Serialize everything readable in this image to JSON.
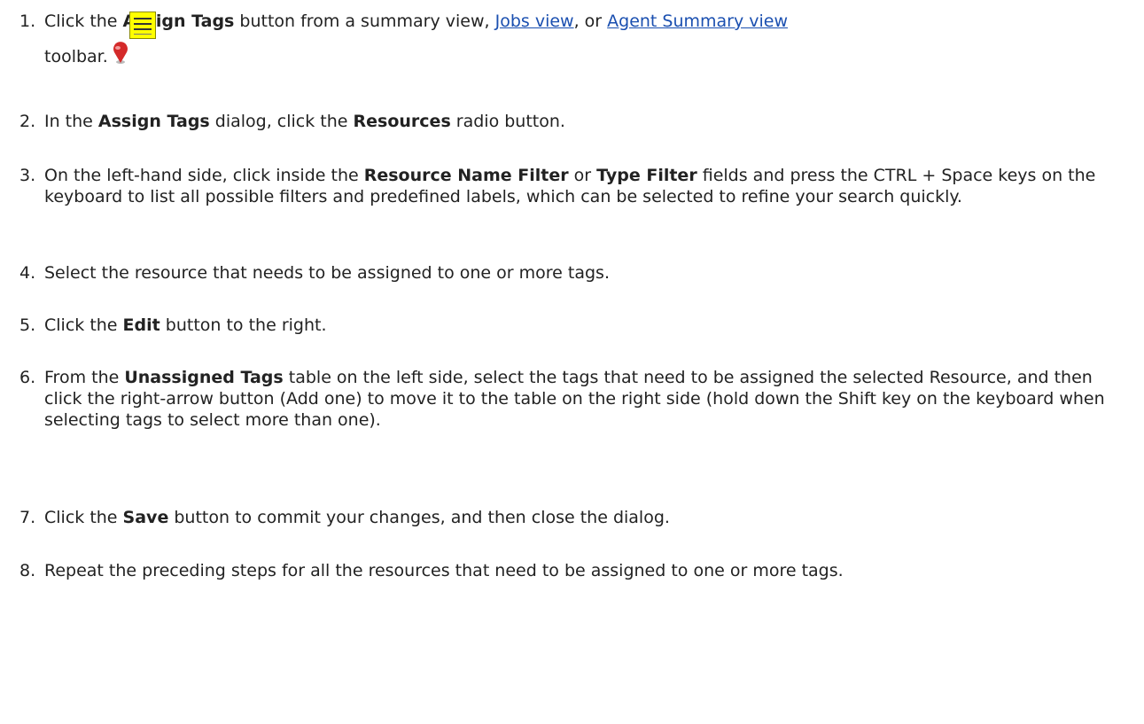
{
  "steps": [
    {
      "num": "1.",
      "p1": "Click the ",
      "b1": "Assign Tags",
      "p2": " button from a summary view, ",
      "link1": "Jobs view",
      "p3": ", or ",
      "link2": "Agent Summary view",
      "p4": "toolbar."
    },
    {
      "num": "2.",
      "p1": "In the ",
      "b1": "Assign Tags",
      "p2": " dialog, click the ",
      "b2": "Resources",
      "p3": " radio button."
    },
    {
      "num": "3.",
      "p1": "On the left-hand side, click inside the ",
      "b1": "Resource Name Filter",
      "p2": " or ",
      "b2": "Type Filter",
      "p3": " fields and press the CTRL + Space keys on the keyboard to list all possible filters and predefined labels, which can be selected to refine your search quickly."
    },
    {
      "num": "4.",
      "p1": "Select the resource that needs to be assigned to one or more tags."
    },
    {
      "num": "5.",
      "p1": "Click the ",
      "b1": "Edit",
      "p2": " button to the right."
    },
    {
      "num": "6.",
      "p1": "From the ",
      "b1": "Unassigned Tags",
      "p2": " table on the left side, select the tags that need to be assigned the selected Resource, and then click the right-arrow button (Add one) to move it to the table on the right side (hold down the Shift key on the keyboard when selecting tags to select more than one)."
    },
    {
      "num": "7.",
      "p1": "Click the ",
      "b1": "Save",
      "p2": " button to commit your changes, and then close the dialog."
    },
    {
      "num": "8.",
      "p1": "Repeat the preceding steps for all the resources that need to be assigned to one or more tags."
    }
  ],
  "icons": {
    "note": "note-icon",
    "pin": "pin-icon",
    "note_color": "#ffff00",
    "pin_color": "#d42a2a"
  },
  "colors": {
    "link": "#1a4fb0",
    "text": "#222222"
  }
}
